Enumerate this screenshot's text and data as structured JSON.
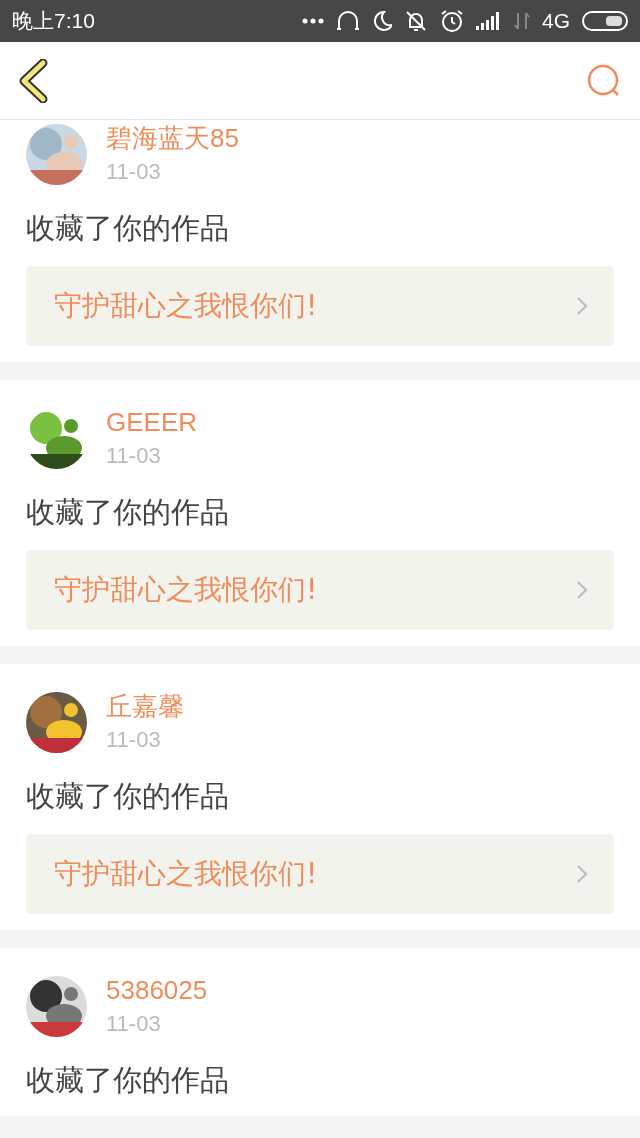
{
  "status_bar": {
    "time": "晚上7:10",
    "network": "4G"
  },
  "notifications": [
    {
      "name": "碧海蓝天85",
      "date": "11-03",
      "action": "收藏了你的作品",
      "work_title": "守护甜心之我恨你们!"
    },
    {
      "name": "GEEER",
      "date": "11-03",
      "action": "收藏了你的作品",
      "work_title": "守护甜心之我恨你们!"
    },
    {
      "name": "丘嘉馨",
      "date": "11-03",
      "action": "收藏了你的作品",
      "work_title": "守护甜心之我恨你们!"
    },
    {
      "name": "5386025",
      "date": "11-03",
      "action": "收藏了你的作品"
    }
  ]
}
